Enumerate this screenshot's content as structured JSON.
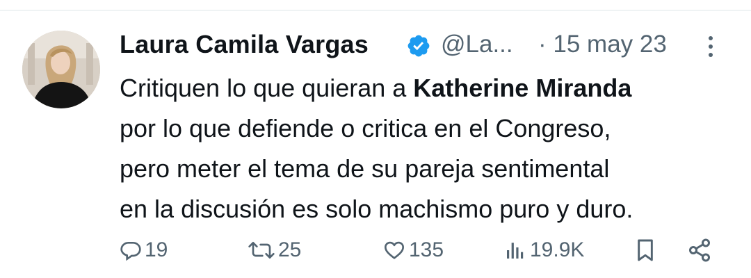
{
  "tweet": {
    "author": {
      "name": "Laura Camila Vargas",
      "handle": "@La...",
      "verified": true
    },
    "timestamp": "· 15 may 23",
    "text_before": "Critiquen lo que quieran a ",
    "text_bold": "Katherine Miranda",
    "text_after": "\npor lo que defiende o critica en el Congreso,\npero meter el tema de su pareja sentimental\nen la discusión es solo machismo puro y duro."
  },
  "actions": {
    "replies": "19",
    "reposts": "25",
    "likes": "135",
    "views": "19.9K"
  },
  "icons": [
    "verified-badge-icon",
    "more-options-icon",
    "reply-icon",
    "repost-icon",
    "like-icon",
    "views-icon",
    "bookmark-icon",
    "share-icon"
  ],
  "colors": {
    "text": "#0f1419",
    "secondary": "#536471",
    "verified_blue": "#1d9bf0",
    "divider": "#eff3f4"
  }
}
